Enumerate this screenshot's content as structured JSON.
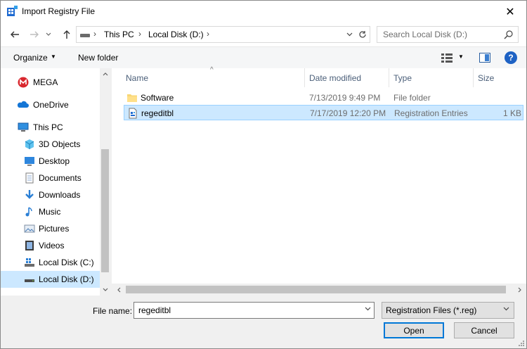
{
  "window": {
    "title": "Import Registry File",
    "close_glyph": "✕"
  },
  "nav": {
    "breadcrumbs": [
      "This PC",
      "Local Disk (D:)"
    ],
    "separator": "›",
    "search_placeholder": "Search Local Disk (D:)"
  },
  "toolbar": {
    "organize_label": "Organize",
    "new_folder_label": "New folder",
    "help_label": "?"
  },
  "sidebar": {
    "items": [
      {
        "label": "MEGA",
        "icon": "mega-icon"
      },
      {
        "label": "OneDrive",
        "icon": "onedrive-icon"
      },
      {
        "label": "This PC",
        "icon": "computer-icon"
      },
      {
        "label": "3D Objects",
        "icon": "cube-icon"
      },
      {
        "label": "Desktop",
        "icon": "desktop-icon"
      },
      {
        "label": "Documents",
        "icon": "documents-icon"
      },
      {
        "label": "Downloads",
        "icon": "download-icon"
      },
      {
        "label": "Music",
        "icon": "music-icon"
      },
      {
        "label": "Pictures",
        "icon": "pictures-icon"
      },
      {
        "label": "Videos",
        "icon": "videos-icon"
      },
      {
        "label": "Local Disk (C:)",
        "icon": "drive-icon"
      },
      {
        "label": "Local Disk (D:)",
        "icon": "drive-icon",
        "selected": true
      }
    ]
  },
  "files": {
    "columns": [
      "Name",
      "Date modified",
      "Type",
      "Size"
    ],
    "rows": [
      {
        "name": "Software",
        "date": "7/13/2019 9:49 PM",
        "type": "File folder",
        "size": "",
        "icon": "folder-icon"
      },
      {
        "name": "regeditbl",
        "date": "7/17/2019 12:20 PM",
        "type": "Registration Entries",
        "size": "1 KB",
        "icon": "reg-file-icon",
        "selected": true
      }
    ]
  },
  "footer": {
    "file_name_label": "File name:",
    "file_name_value": "regeditbl",
    "file_type_value": "Registration Files (*.reg)",
    "open_label": "Open",
    "cancel_label": "Cancel"
  },
  "colors": {
    "selection": "#cce8ff",
    "accent": "#0078d7",
    "header_text": "#4c607a"
  }
}
